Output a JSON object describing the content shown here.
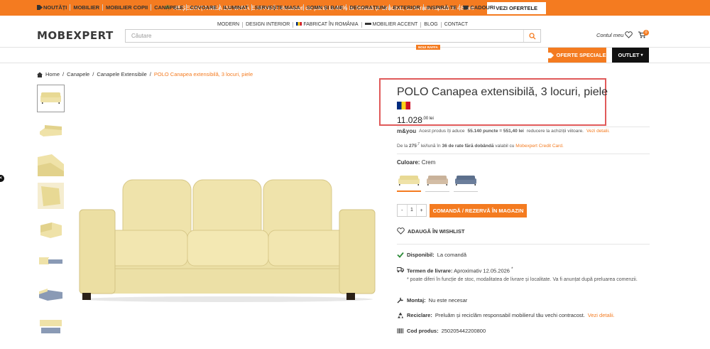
{
  "promo": {
    "text": "🌴 REȘEDINȚA MEA DE VARĂ E AFARĂ! Reduceri de până la 40% la Terasă și Grădină, cu livrare rapidă în 48 ore",
    "button": "VEZI OFERTELE"
  },
  "topnav": [
    "MODERN",
    "DESIGN INTERIOR",
    "FABRICAT ÎN ROMÂNIA",
    "MOBILIER ACCENT",
    "BLOG",
    "CONTACT"
  ],
  "header": {
    "logo": "MOBEXPERT",
    "search_placeholder": "Căutare",
    "account": "Contul meu",
    "cart_count": "0"
  },
  "menu": [
    "NOUTĂȚI",
    "MOBILIER",
    "MOBILIER COPII",
    "CANAPELE",
    "COVOARE",
    "ILUMINAT",
    "SERVEȘTE MASA",
    "SOMN ȘI BAIE",
    "DECORAȚIUNI",
    "EXTERIOR",
    "INSPIRĂ-TE",
    "CADOURI"
  ],
  "menu_badge": "NOU! RAFFA",
  "oferte": "OFERTE SPECIALE",
  "outlet": "OUTLET",
  "breadcrumb": [
    "Home",
    "Canapele",
    "Canapele Extensibile",
    "POLO Canapea extensibilă, 3 locuri, piele"
  ],
  "product": {
    "title": "POLO Canapea extensibilă, 3 locuri, piele",
    "price_main": "11.028",
    "price_dec": ",00 lei",
    "myou_logo": "m&you",
    "myou_text_a": "Acest produs îți aduce",
    "myou_points": "55.140 puncte = 551,40 lei",
    "myou_text_b": "reducere la achiziții viitoare.",
    "myou_link": "Vezi detalii.",
    "rate_a": "De la",
    "rate_val": "275",
    "rate_sup": ",7",
    "rate_b": "lei/lună în",
    "rate_months": "36 de rate fără dobândă",
    "rate_c": "valabil cu",
    "rate_link": "Mobexpert Credit Card.",
    "culoare_label": "Culoare:",
    "culoare_value": "Crem",
    "qty_minus": "-",
    "qty_value": "1",
    "qty_plus": "+",
    "add_button": "COMANDĂ / REZERVĂ ÎN MAGAZIN",
    "wishlist": "ADAUGĂ ÎN WISHLIST",
    "disponibil_label": "Disponibil:",
    "disponibil_value": "La comandă",
    "livrare_label": "Termen de livrare:",
    "livrare_value": "Aproximativ 12.05.2026",
    "livrare_note": "* poate diferi în funcție de stoc, modalitatea de livrare și localitate. Va fi anunțat după preluarea comenzii.",
    "montaj_label": "Montaj:",
    "montaj_value": "Nu este necesar",
    "reciclare_label": "Reciclare:",
    "reciclare_value": "Preluăm și reciclăm responsabil mobilierul tău vechi contracost.",
    "reciclare_link": "Vezi detalii.",
    "cod_label": "Cod produs:",
    "cod_value": "250205442200800"
  },
  "colors": {
    "accent": "#f47b20",
    "sofa_cream": "#efe2a8",
    "sofa_beige": "#c9b29a",
    "sofa_blue": "#5c6f8c"
  }
}
